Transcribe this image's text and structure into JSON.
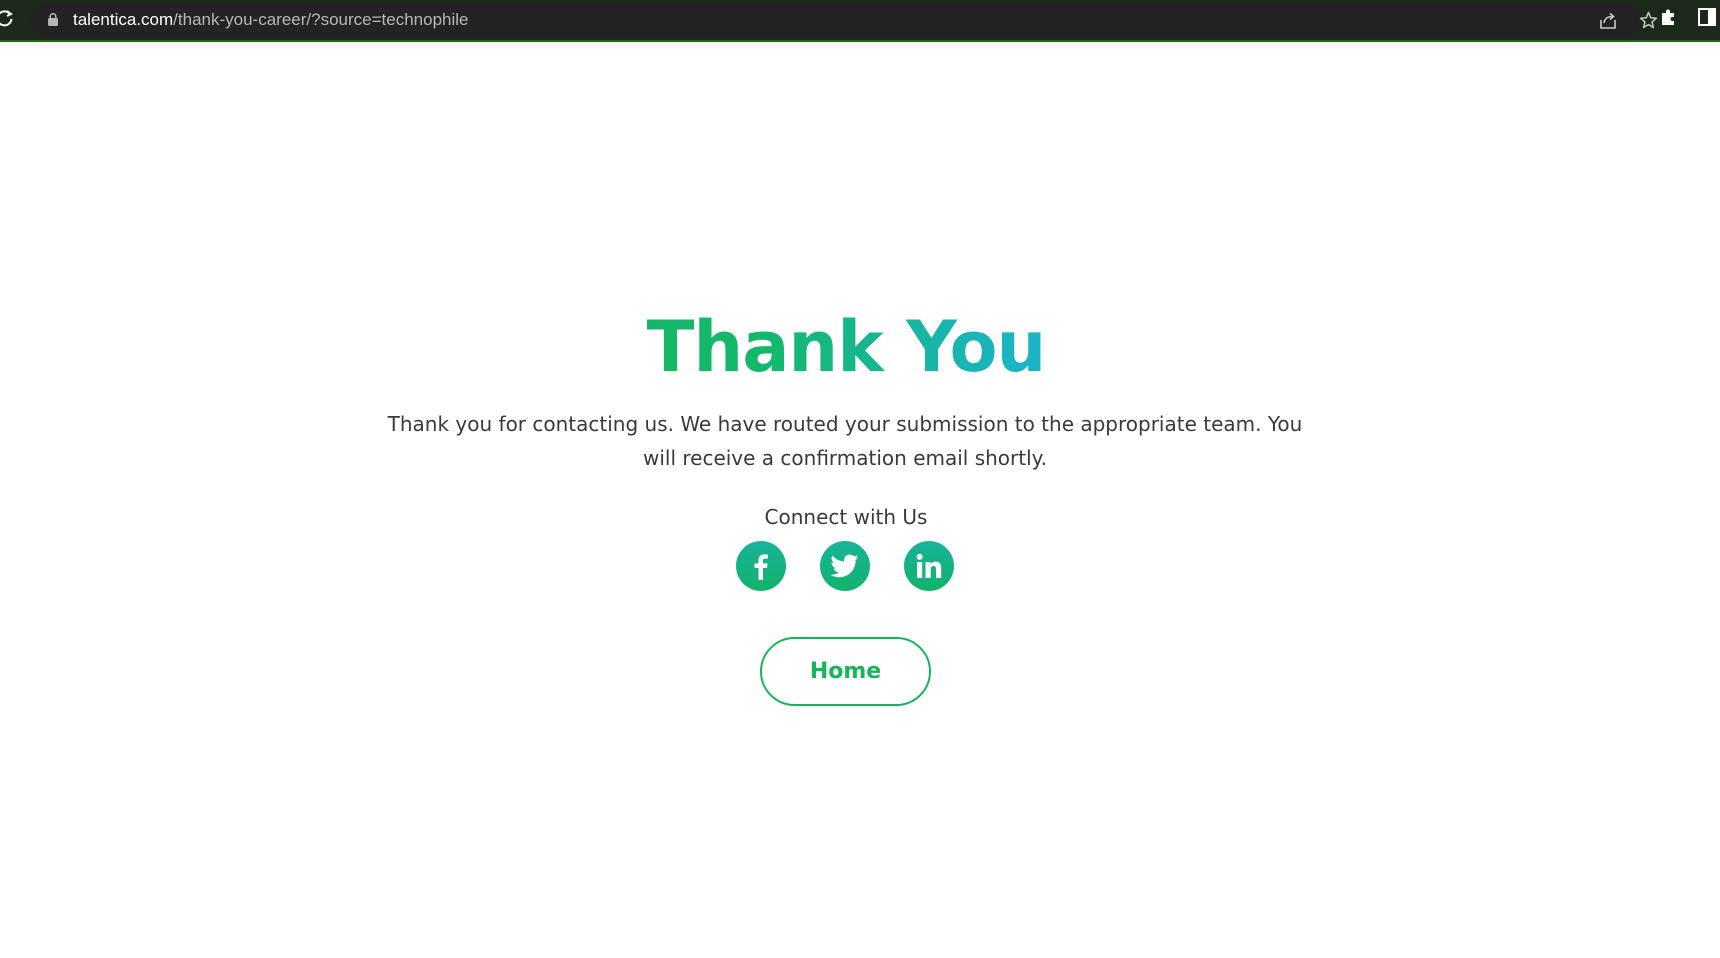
{
  "browser": {
    "url_host": "talentica.com",
    "url_path": "/thank-you-career/?source=technophile",
    "icons": [
      "reload-icon",
      "lock-icon",
      "share-icon",
      "star-icon",
      "extensions-icon",
      "side-panel-icon"
    ]
  },
  "page": {
    "title": "Thank You",
    "message": "Thank you for contacting us. We have routed your submission to the appropriate team. You will receive a confirmation email shortly.",
    "connect_label": "Connect with Us",
    "social_icons": [
      "facebook-icon",
      "twitter-icon",
      "linkedin-icon"
    ],
    "home_button_label": "Home"
  },
  "colors": {
    "title_gradient_start": "#12b45a",
    "title_gradient_end": "#1bb0d6",
    "accent_green": "#17b55a",
    "text": "#3a3a3a",
    "browser_bar": "#1d2a1b"
  }
}
